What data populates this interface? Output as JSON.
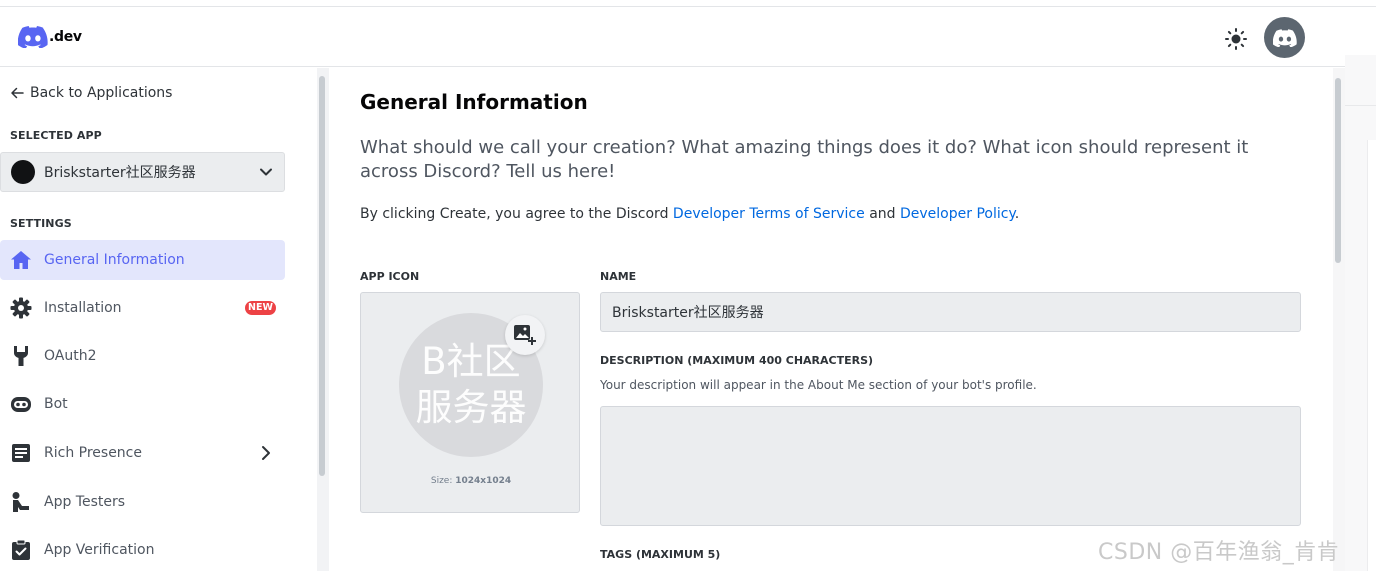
{
  "header": {
    "logo_text": ".dev",
    "theme_icon": "sun-icon",
    "avatar_icon": "discord-logo-icon"
  },
  "sidebar": {
    "back_label": "Back to Applications",
    "selected_app_heading": "SELECTED APP",
    "selected_app_name": "Briskstarter社区服务器",
    "settings_heading": "SETTINGS",
    "items": [
      {
        "label": "General Information",
        "icon": "home-icon",
        "active": true
      },
      {
        "label": "Installation",
        "icon": "gear-icon",
        "badge": "NEW"
      },
      {
        "label": "OAuth2",
        "icon": "wrench-icon"
      },
      {
        "label": "Bot",
        "icon": "bot-icon"
      },
      {
        "label": "Rich Presence",
        "icon": "document-icon",
        "expandable": true
      },
      {
        "label": "App Testers",
        "icon": "person-icon"
      },
      {
        "label": "App Verification",
        "icon": "clipboard-check-icon"
      }
    ]
  },
  "main": {
    "title": "General Information",
    "intro": "What should we call your creation? What amazing things does it do? What icon should represent it across Discord? Tell us here!",
    "terms_prefix": "By clicking Create, you agree to the Discord ",
    "terms_link1": "Developer Terms of Service",
    "terms_mid": " and ",
    "terms_link2": "Developer Policy",
    "terms_suffix": ".",
    "app_icon_label": "APP ICON",
    "app_icon_initials": "B社区服务器",
    "size_prefix": "Size: ",
    "size_value": "1024x1024",
    "name_label": "NAME",
    "name_value": "Briskstarter社区服务器",
    "description_label": "DESCRIPTION (MAXIMUM 400 CHARACTERS)",
    "description_help": "Your description will appear in the About Me section of your bot's profile.",
    "description_value": "",
    "tags_label": "TAGS (MAXIMUM 5)"
  },
  "watermark": "CSDN @百年渔翁_肯肯",
  "colors": {
    "accent": "#5865f2",
    "active_bg": "#e3e6fc",
    "link": "#0068e0",
    "badge": "#ed4245"
  }
}
